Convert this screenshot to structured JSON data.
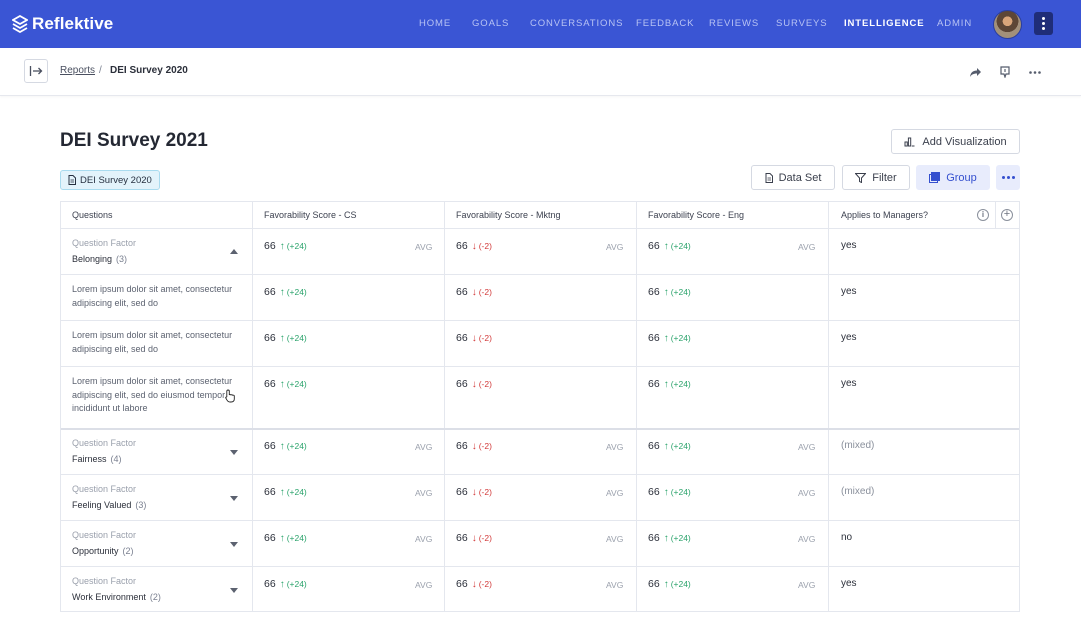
{
  "app": {
    "name": "Reflektive"
  },
  "nav": {
    "items": [
      {
        "label": "HOME",
        "active": false
      },
      {
        "label": "GOALS",
        "active": false
      },
      {
        "label": "CONVERSATIONS",
        "active": false
      },
      {
        "label": "FEEDBACK",
        "active": false
      },
      {
        "label": "REVIEWS",
        "active": false
      },
      {
        "label": "SURVEYS",
        "active": false
      },
      {
        "label": "INTELLIGENCE",
        "active": true
      },
      {
        "label": "ADMIN",
        "active": false
      }
    ]
  },
  "breadcrumb": {
    "parent": "Reports",
    "separator": "/",
    "current": "DEI Survey 2020"
  },
  "page": {
    "title": "DEI Survey 2021",
    "tag": "DEI Survey 2020"
  },
  "toolbar": {
    "add_visualization": "Add Visualization",
    "data_set": "Data Set",
    "filter": "Filter",
    "group": "Group"
  },
  "table": {
    "headers": [
      "Questions",
      "Favorability Score - CS",
      "Favorability Score - Mktng",
      "Favorability Score - Eng",
      "Applies to Managers?"
    ],
    "factor_label": "Question Factor",
    "avg_label": "AVG",
    "rows": [
      {
        "kind": "factor",
        "name": "Belonging",
        "count": "(3)",
        "expanded": true,
        "cs": {
          "score": "66",
          "delta": "(+24)",
          "dir": "up"
        },
        "mk": {
          "score": "66",
          "delta": "(-2)",
          "dir": "down"
        },
        "eng": {
          "score": "66",
          "delta": "(+24)",
          "dir": "up"
        },
        "mgr": "yes"
      },
      {
        "kind": "question",
        "text": "Lorem ipsum dolor sit amet, consectetur adipiscing elit, sed do",
        "cs": {
          "score": "66",
          "delta": "(+24)",
          "dir": "up"
        },
        "mk": {
          "score": "66",
          "delta": "(-2)",
          "dir": "down"
        },
        "eng": {
          "score": "66",
          "delta": "(+24)",
          "dir": "up"
        },
        "mgr": "yes"
      },
      {
        "kind": "question",
        "text": "Lorem ipsum dolor sit amet, consectetur adipiscing elit, sed do",
        "cs": {
          "score": "66",
          "delta": "(+24)",
          "dir": "up"
        },
        "mk": {
          "score": "66",
          "delta": "(-2)",
          "dir": "down"
        },
        "eng": {
          "score": "66",
          "delta": "(+24)",
          "dir": "up"
        },
        "mgr": "yes"
      },
      {
        "kind": "question",
        "text": "Lorem ipsum dolor sit amet, consectetur adipiscing elit, sed do eiusmod tempor incididunt ut labore",
        "cs": {
          "score": "66",
          "delta": "(+24)",
          "dir": "up"
        },
        "mk": {
          "score": "66",
          "delta": "(-2)",
          "dir": "down"
        },
        "eng": {
          "score": "66",
          "delta": "(+24)",
          "dir": "up"
        },
        "mgr": "yes"
      },
      {
        "kind": "factor",
        "name": "Fairness",
        "count": "(4)",
        "expanded": false,
        "cs": {
          "score": "66",
          "delta": "(+24)",
          "dir": "up"
        },
        "mk": {
          "score": "66",
          "delta": "(-2)",
          "dir": "down"
        },
        "eng": {
          "score": "66",
          "delta": "(+24)",
          "dir": "up"
        },
        "mgr": "(mixed)"
      },
      {
        "kind": "factor",
        "name": "Feeling Valued",
        "count": "(3)",
        "expanded": false,
        "cs": {
          "score": "66",
          "delta": "(+24)",
          "dir": "up"
        },
        "mk": {
          "score": "66",
          "delta": "(-2)",
          "dir": "down"
        },
        "eng": {
          "score": "66",
          "delta": "(+24)",
          "dir": "up"
        },
        "mgr": "(mixed)"
      },
      {
        "kind": "factor",
        "name": "Opportunity",
        "count": "(2)",
        "expanded": false,
        "cs": {
          "score": "66",
          "delta": "(+24)",
          "dir": "up"
        },
        "mk": {
          "score": "66",
          "delta": "(-2)",
          "dir": "down"
        },
        "eng": {
          "score": "66",
          "delta": "(+24)",
          "dir": "up"
        },
        "mgr": "no"
      },
      {
        "kind": "factor",
        "name": "Work Environment",
        "count": "(2)",
        "expanded": false,
        "cs": {
          "score": "66",
          "delta": "(+24)",
          "dir": "up"
        },
        "mk": {
          "score": "66",
          "delta": "(-2)",
          "dir": "down"
        },
        "eng": {
          "score": "66",
          "delta": "(+24)",
          "dir": "up"
        },
        "mgr": "yes"
      }
    ]
  }
}
